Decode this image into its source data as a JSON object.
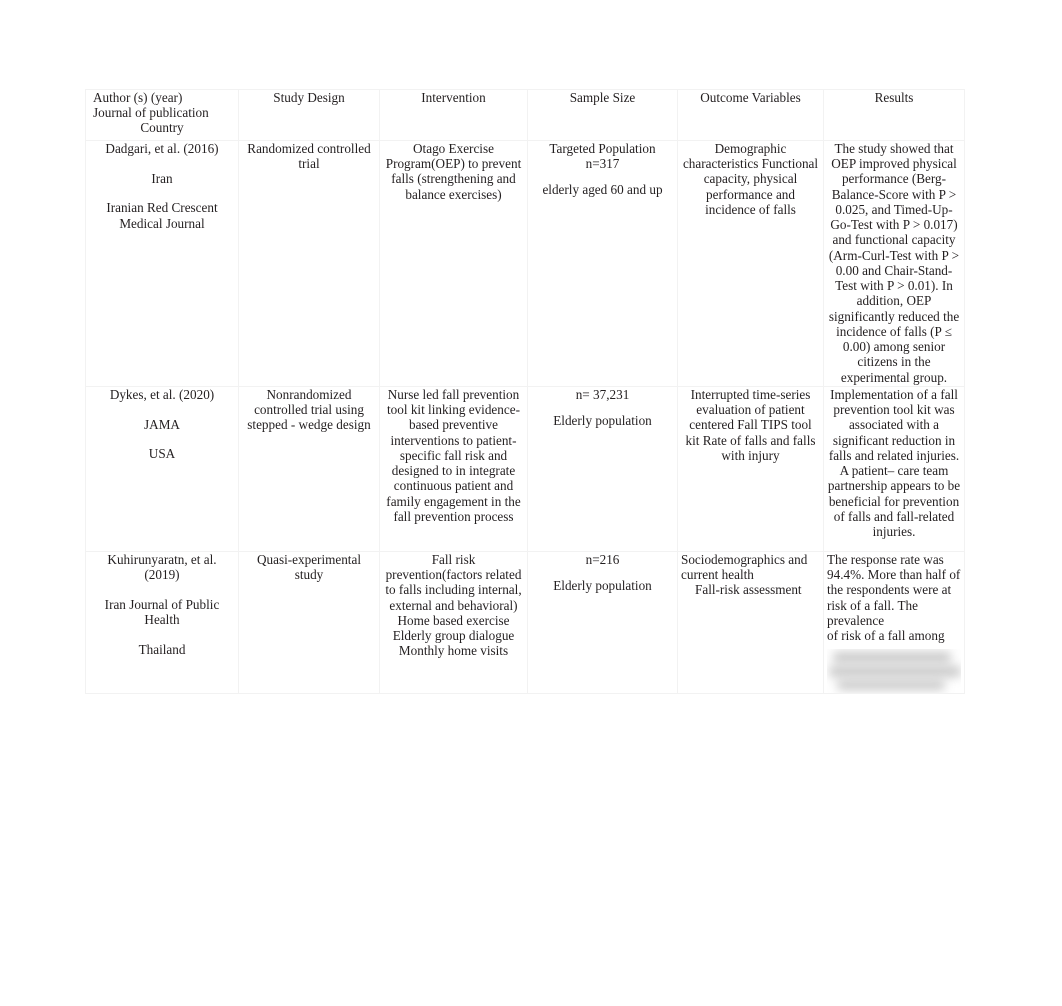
{
  "document": {
    "type": "literature-review-table",
    "background_color": "#ffffff",
    "text_color": "#231f20",
    "border_color": "#f2f2f2"
  },
  "table": {
    "headers": [
      {
        "id": "author",
        "lines": [
          "Author (s) (year)",
          "Journal of publication",
          "Country"
        ]
      },
      {
        "id": "design",
        "lines": [
          "Study Design"
        ]
      },
      {
        "id": "intervention",
        "lines": [
          "Intervention"
        ]
      },
      {
        "id": "sample",
        "lines": [
          "Sample Size"
        ]
      },
      {
        "id": "outcome",
        "lines": [
          "Outcome Variables"
        ]
      },
      {
        "id": "results",
        "lines": [
          "Results"
        ]
      }
    ],
    "header_labels": {
      "author_line1": "Author (s) (year)",
      "author_line2": "Journal of publication",
      "author_line3": "Country",
      "design": "Study Design",
      "intervention": "Intervention",
      "sample": "Sample Size",
      "outcome": "Outcome Variables",
      "results": "Results"
    },
    "rows": [
      {
        "author": {
          "citation": "Dadgari, et al. (2016)",
          "country": "Iran",
          "journal": "Iranian Red Crescent Medical Journal"
        },
        "design": "Randomized controlled trial",
        "intervention": "Otago Exercise Program(OEP)  to prevent falls (strengthening and balance exercises)",
        "sample": {
          "line1": "Targeted Population n=317",
          "line2": "elderly aged 60 and up"
        },
        "outcome": "Demographic characteristics Functional capacity, physical performance and incidence of falls",
        "results": "The study showed that OEP  improved physical performance (Berg-Balance-Score with P > 0.025, and Timed-Up-Go-Test with P > 0.017) and functional capacity (Arm-Curl-Test with P > 0.00 and Chair-Stand-Test with P > 0.01). In addition, OEP significantly reduced the incidence of falls (P ≤ 0.00) among senior citizens in the experimental group."
      },
      {
        "author": {
          "citation": "Dykes, et al. (2020)",
          "country": "JAMA",
          "journal": "USA"
        },
        "design": "Nonrandomized controlled trial using stepped - wedge design",
        "intervention": "Nurse led fall prevention tool kit linking evidence-based preventive interventions to patient-specific fall risk and designed to in integrate continuous patient and family engagement in the fall prevention process",
        "sample": {
          "line1": "n= 37,231",
          "line2": "Elderly population"
        },
        "outcome": "Interrupted time-series evaluation of patient centered Fall TIPS tool kit Rate of falls and falls with injury",
        "results": "Implementation of a fall prevention tool kit was associated with a significant reduction in falls and related injuries. A patient– care team partnership appears to be beneficial for prevention of falls and fall-related injuries."
      },
      {
        "author": {
          "citation": "Kuhirunyaratn, et al. (2019)",
          "country": "Iran Journal of Public Health",
          "journal": "Thailand"
        },
        "design": "Quasi-experimental study",
        "intervention": "Fall risk prevention(factors related to falls including internal, external and behavioral) Home based exercise Elderly group dialogue Monthly home visits",
        "sample": {
          "line1": "n=216",
          "line2": "Elderly population"
        },
        "outcome_line1": "Sociodemographics and current health",
        "outcome_line2": "Fall-risk assessment",
        "results_visible": "The response rate was 94.4%. More than half of the respondents were at risk of a fall. The prevalence",
        "results_visible_2": "of risk of a fall among",
        "results_redacted_note": "blurred"
      }
    ],
    "row_cells": {
      "r1c2": "Randomized controlled trial",
      "r1c3": "Otago Exercise Program(OEP)  to prevent falls (strengthening and balance exercises)",
      "r1c5": "Demographic characteristics Functional capacity, physical performance and incidence of falls",
      "r1c6": "The study showed that OEP  improved physical performance (Berg-Balance-Score with P > 0.025, and Timed-Up-Go-Test with P > 0.017) and functional capacity (Arm-Curl-Test with P > 0.00 and Chair-Stand-Test with P > 0.01). In addition, OEP significantly reduced the incidence of falls (P ≤ 0.00) among senior citizens in the experimental group.",
      "r2c2": "Nonrandomized controlled trial using stepped - wedge design",
      "r2c3": "Nurse led fall prevention tool kit linking evidence-based preventive interventions to patient-specific fall risk and designed to in integrate continuous patient and family engagement in the fall prevention process",
      "r2c5": "Interrupted time-series evaluation of patient centered Fall TIPS tool kit Rate of falls and falls with injury",
      "r2c6": "Implementation of a fall prevention tool kit was associated with a significant reduction in falls and related injuries. A patient– care team partnership appears to be beneficial for prevention of falls and fall-related injuries.",
      "r3c2": "Quasi-experimental study",
      "r3c3": "Fall risk prevention(factors related to falls including internal, external and behavioral) Home based exercise Elderly group dialogue Monthly home visits",
      "r3c6a": "The response rate was 94.4%. More than half of the respondents were at risk of a fall. The prevalence",
      "r3c6b": "of risk of a fall among"
    }
  }
}
